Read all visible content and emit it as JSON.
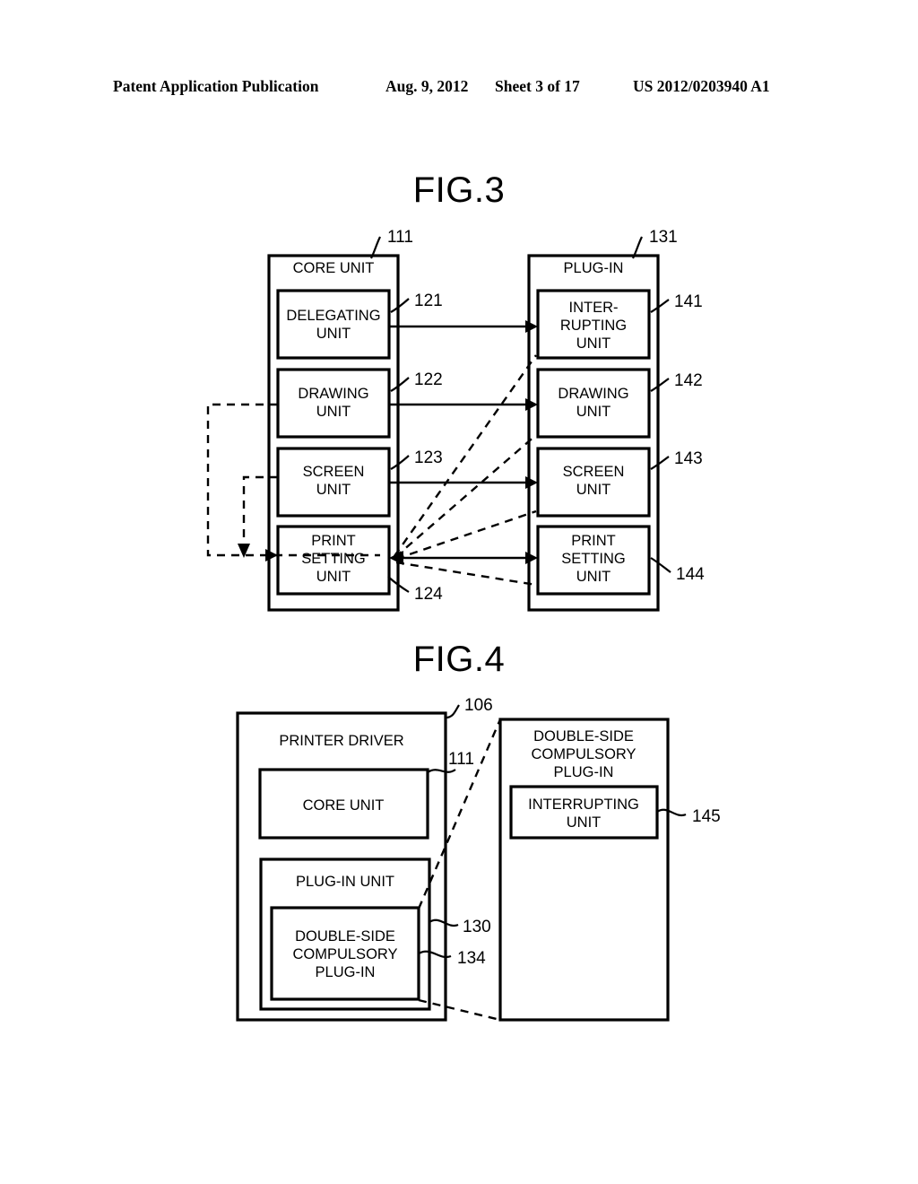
{
  "header": {
    "publication": "Patent Application Publication",
    "date": "Aug. 9, 2012",
    "sheet": "Sheet 3 of 17",
    "number": "US 2012/0203940 A1"
  },
  "figures": [
    {
      "title": "FIG.3",
      "containers": [
        {
          "id": "core-unit",
          "label": "CORE UNIT",
          "ref": "111"
        },
        {
          "id": "plug-in",
          "label": "PLUG-IN",
          "ref": "131"
        }
      ],
      "core_blocks": [
        {
          "id": "delegating-unit",
          "lines": [
            "DELEGATING",
            "UNIT"
          ],
          "ref": "121"
        },
        {
          "id": "drawing-unit",
          "lines": [
            "DRAWING",
            "UNIT"
          ],
          "ref": "122"
        },
        {
          "id": "screen-unit",
          "lines": [
            "SCREEN",
            "UNIT"
          ],
          "ref": "123"
        },
        {
          "id": "print-setting-unit",
          "lines": [
            "PRINT",
            "SETTING",
            "UNIT"
          ],
          "ref": "124"
        }
      ],
      "plugin_blocks": [
        {
          "id": "interrupting-unit",
          "lines": [
            "INTER-",
            "RUPTING",
            "UNIT"
          ],
          "ref": "141"
        },
        {
          "id": "drawing-unit",
          "lines": [
            "DRAWING",
            "UNIT"
          ],
          "ref": "142"
        },
        {
          "id": "screen-unit",
          "lines": [
            "SCREEN",
            "UNIT"
          ],
          "ref": "143"
        },
        {
          "id": "print-setting-unit",
          "lines": [
            "PRINT",
            "SETTING",
            "UNIT"
          ],
          "ref": "144"
        }
      ]
    },
    {
      "title": "FIG.4",
      "containers": [
        {
          "id": "printer-driver",
          "label": "PRINTER DRIVER",
          "ref": "106"
        },
        {
          "id": "double-side-compulsory-plug-in",
          "lines": [
            "DOUBLE-SIDE",
            "COMPULSORY",
            "PLUG-IN"
          ]
        }
      ],
      "driver_blocks": [
        {
          "id": "core-unit",
          "label": "CORE UNIT",
          "ref": "111"
        },
        {
          "id": "plug-in-unit",
          "label": "PLUG-IN UNIT",
          "ref": "130"
        },
        {
          "id": "double-side-compulsory-plug-in",
          "lines": [
            "DOUBLE-SIDE",
            "COMPULSORY",
            "PLUG-IN"
          ],
          "ref": "134"
        }
      ],
      "expanded_blocks": [
        {
          "id": "interrupting-unit",
          "lines": [
            "INTERRUPTING",
            "UNIT"
          ],
          "ref": "145"
        }
      ]
    }
  ],
  "text": {
    "fig3_title": "FIG.3",
    "fig4_title": "FIG.4",
    "core_unit": "CORE UNIT",
    "plug_in": "PLUG-IN",
    "delegating_1": "DELEGATING",
    "unit": "UNIT",
    "drawing": "DRAWING",
    "screen": "SCREEN",
    "print": "PRINT",
    "setting": "SETTING",
    "inter": "INTER-",
    "rupting": "RUPTING",
    "interrupting": "INTERRUPTING",
    "printer_driver": "PRINTER DRIVER",
    "plug_in_unit": "PLUG-IN UNIT",
    "double_side": "DOUBLE-SIDE",
    "compulsory": "COMPULSORY",
    "plugin_word": "PLUG-IN",
    "ref_111": "111",
    "ref_131": "131",
    "ref_121": "121",
    "ref_122": "122",
    "ref_123": "123",
    "ref_124": "124",
    "ref_141": "141",
    "ref_142": "142",
    "ref_143": "143",
    "ref_144": "144",
    "ref_106": "106",
    "ref_111b": "111",
    "ref_130": "130",
    "ref_134": "134",
    "ref_145": "145"
  }
}
